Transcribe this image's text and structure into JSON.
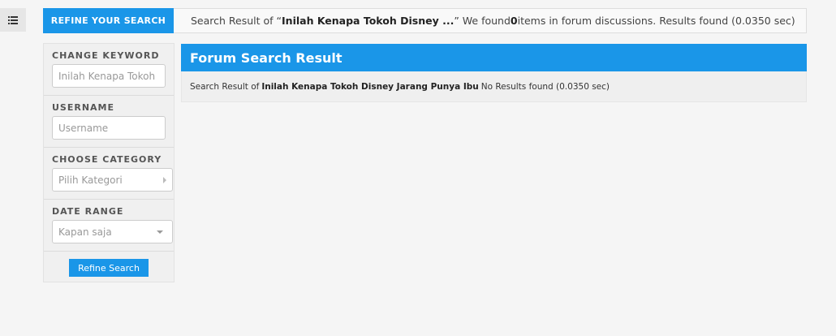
{
  "menu": {
    "icon": "list-icon"
  },
  "topbar": {
    "tab_label": "REFINE YOUR SEARCH",
    "result_prefix": "Search Result of “",
    "query": "Inilah Kenapa Tokoh Disney ...",
    "found_prefix": "” We found ",
    "count": "0",
    "found_suffix": " items in forum discussions. Results found (0.0350 sec)"
  },
  "sidebar": {
    "keyword": {
      "title": "CHANGE KEYWORD",
      "value": "Inilah Kenapa Tokoh"
    },
    "username": {
      "title": "USERNAME",
      "placeholder": "Username"
    },
    "category": {
      "title": "CHOOSE CATEGORY",
      "value": "Pilih Kategori",
      "icon": "chevron-right-icon"
    },
    "date": {
      "title": "DATE RANGE",
      "value": "Kapan saja",
      "icon": "chevron-down-icon"
    },
    "refine_button": "Refine Search"
  },
  "main": {
    "title": "Forum Search Result",
    "result_prefix": "Search Result of",
    "query": "Inilah Kenapa Tokoh Disney Jarang Punya Ibu",
    "result_suffix": "No Results found (0.0350 sec)"
  },
  "colors": {
    "accent": "#1a96e8",
    "background": "#f5f5f5"
  }
}
